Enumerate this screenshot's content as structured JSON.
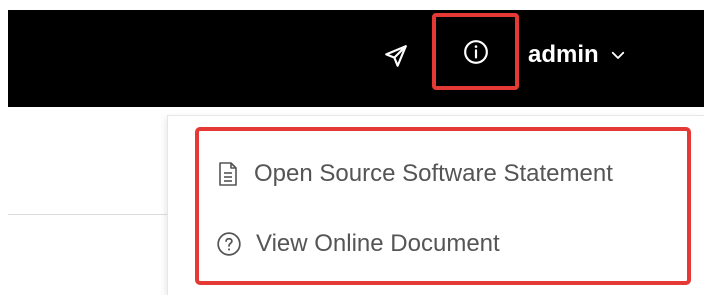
{
  "header": {
    "username": "admin",
    "icons": {
      "send": "send-icon",
      "info": "info-circle-icon",
      "chevron": "chevron-down-icon"
    }
  },
  "dropdown": {
    "items": [
      {
        "label": "Open Source Software Statement",
        "icon": "document-icon"
      },
      {
        "label": "View Online Document",
        "icon": "question-circle-icon"
      }
    ]
  },
  "colors": {
    "topbar": "#000000",
    "highlight": "#e53935",
    "menu_text": "#555555"
  }
}
